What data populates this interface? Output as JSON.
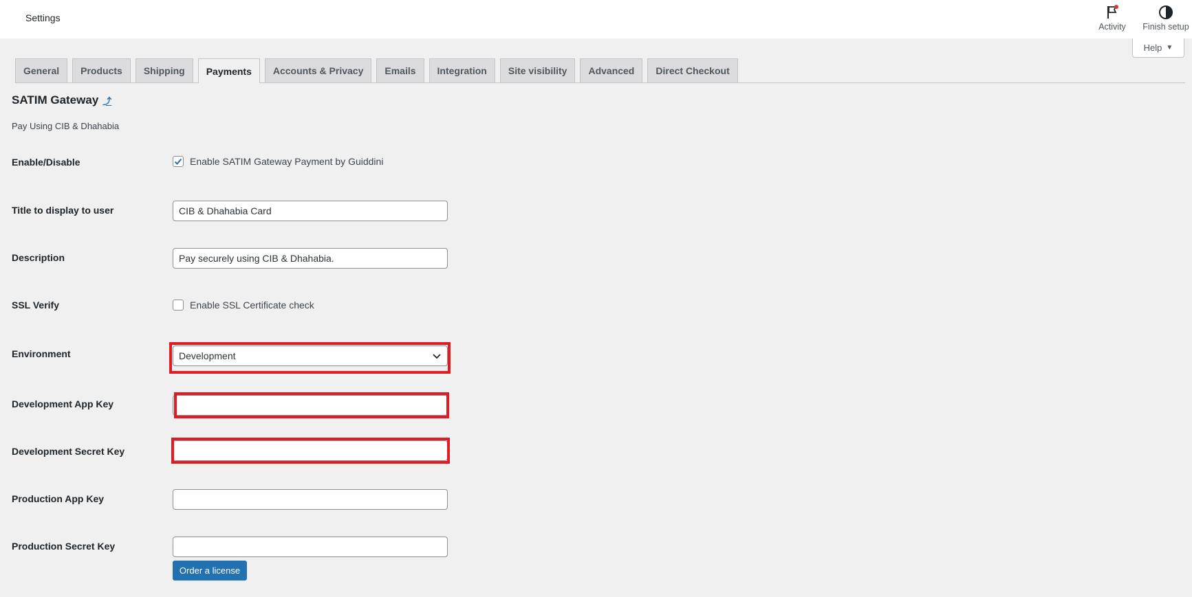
{
  "header": {
    "title": "Settings",
    "activity_label": "Activity",
    "activity_icon": "flag-icon",
    "finish_setup_label": "Finish setup",
    "finish_setup_icon": "half-circle-icon",
    "help_label": "Help"
  },
  "tabs": [
    {
      "label": "General"
    },
    {
      "label": "Products"
    },
    {
      "label": "Shipping"
    },
    {
      "label": "Payments",
      "active": true
    },
    {
      "label": "Accounts & Privacy"
    },
    {
      "label": "Emails"
    },
    {
      "label": "Integration"
    },
    {
      "label": "Site visibility"
    },
    {
      "label": "Advanced"
    },
    {
      "label": "Direct Checkout"
    }
  ],
  "gateway": {
    "title": "SATIM Gateway",
    "back_link": "⤴",
    "description": "Pay Using CIB & Dhahabia"
  },
  "fields": {
    "enable": {
      "label": "Enable/Disable",
      "checkbox_label": "Enable SATIM Gateway Payment by Guiddini",
      "checked": true
    },
    "title": {
      "label": "Title to display to user",
      "value": "CIB & Dhahabia Card"
    },
    "description": {
      "label": "Description",
      "value": "Pay securely using CIB & Dhahabia."
    },
    "ssl": {
      "label": "SSL Verify",
      "checkbox_label": "Enable SSL Certificate check",
      "checked": false
    },
    "environment": {
      "label": "Environment",
      "selected": "Development"
    },
    "dev_app_key": {
      "label": "Development App Key",
      "value": ""
    },
    "dev_secret_key": {
      "label": "Development Secret Key",
      "value": ""
    },
    "prod_app_key": {
      "label": "Production App Key",
      "value": ""
    },
    "prod_secret_key": {
      "label": "Production Secret Key",
      "value": ""
    }
  },
  "order_license_label": "Order a license",
  "colors": {
    "accent": "#2271b1",
    "highlight": "#e11b22",
    "background": "#f0f0f1"
  }
}
